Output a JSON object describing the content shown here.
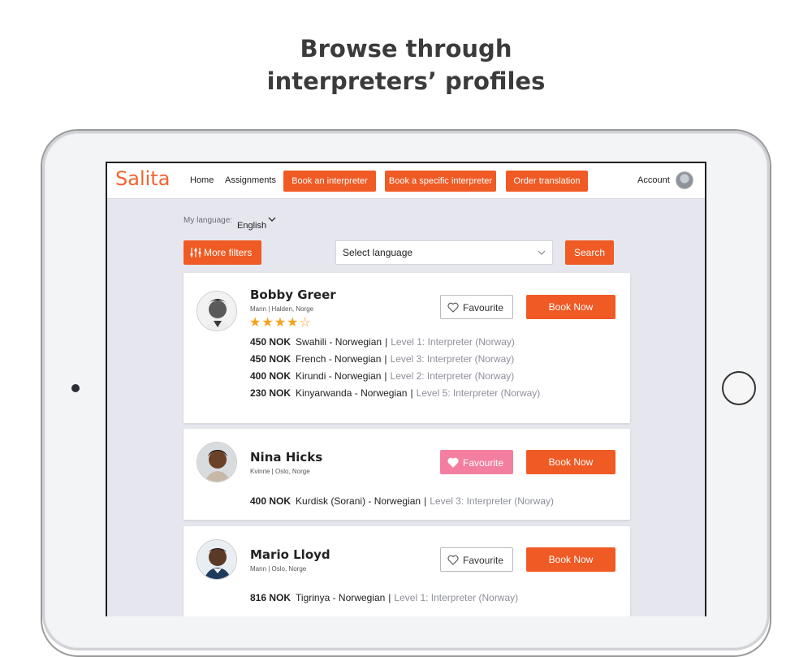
{
  "headline": {
    "line1": "Browse through",
    "line2": "interpreters’ profiles"
  },
  "navbar": {
    "logo": "Salita",
    "links": [
      "Home",
      "Assignments"
    ],
    "buttons": [
      "Book an interpreter",
      "Book a specific interpreter",
      "Order translation"
    ],
    "account": "Account"
  },
  "language": {
    "label": "My language:",
    "value": "English"
  },
  "filters": {
    "more_filters": "More filters",
    "select_placeholder": "Select language",
    "search": "Search"
  },
  "colors": {
    "accent": "#f05a24",
    "favourite_active": "#f47e9f",
    "stars": "#f7a21c"
  },
  "interpreters": [
    {
      "name": "Bobby Greer",
      "meta": "Mann | Halden, Norge",
      "rating": 4,
      "rating_max": 5,
      "favourite": false,
      "favourite_label": "Favourite",
      "book_label": "Book Now",
      "rates": [
        {
          "price": "450 NOK",
          "pair": "Swahili - Norwegian",
          "level": "Level 1: Interpreter (Norway)"
        },
        {
          "price": "450 NOK",
          "pair": "French - Norwegian",
          "level": "Level 3: Interpreter (Norway)"
        },
        {
          "price": "400 NOK",
          "pair": "Kirundi - Norwegian",
          "level": "Level 2: Interpreter (Norway)"
        },
        {
          "price": "230 NOK",
          "pair": "Kinyarwanda - Norwegian",
          "level": "Level 5: Interpreter (Norway)"
        }
      ]
    },
    {
      "name": "Nina Hicks",
      "meta": "Kvinne | Oslo, Norge",
      "favourite": true,
      "favourite_label": "Favourite",
      "book_label": "Book Now",
      "rates": [
        {
          "price": "400 NOK",
          "pair": "Kurdisk (Sorani) - Norwegian",
          "level": "Level 3: Interpreter (Norway)"
        }
      ]
    },
    {
      "name": "Mario Lloyd",
      "meta": "Mann | Oslo, Norge",
      "favourite": false,
      "favourite_label": "Favourite",
      "book_label": "Book Now",
      "rates": [
        {
          "price": "816 NOK",
          "pair": "Tigrinya - Norwegian",
          "level": "Level 1: Interpreter (Norway)"
        }
      ]
    }
  ]
}
